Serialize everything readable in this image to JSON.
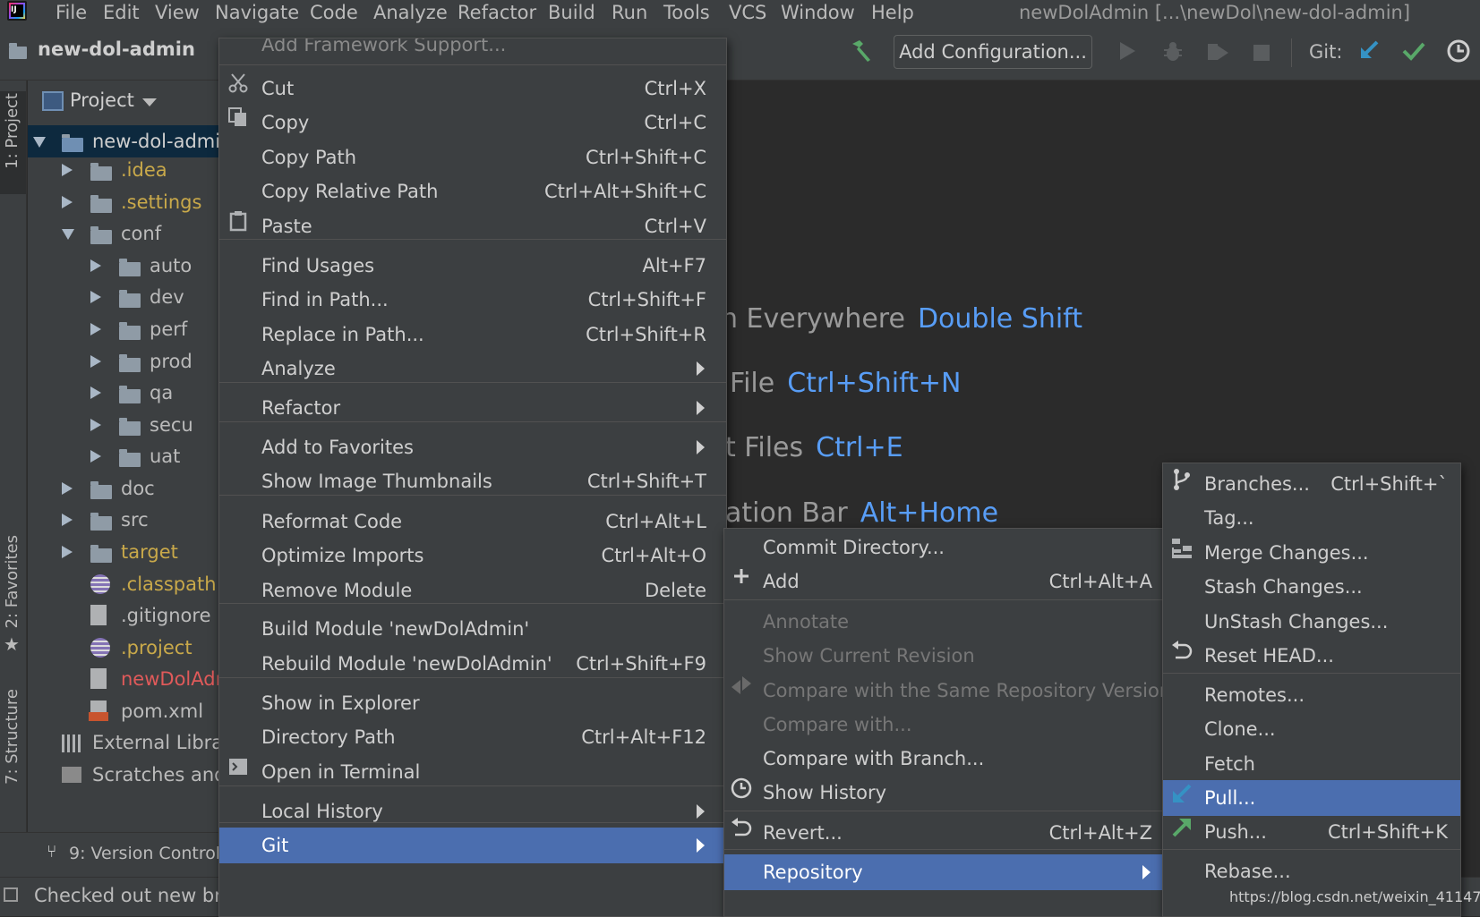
{
  "menubar": {
    "items": [
      "File",
      "Edit",
      "View",
      "Navigate",
      "Code",
      "Analyze",
      "Refactor",
      "Build",
      "Run",
      "Tools",
      "VCS",
      "Window",
      "Help"
    ],
    "window_title": "newDolAdmin [...\\newDol\\new-dol-admin]"
  },
  "toolbar": {
    "project_name": "new-dol-admin",
    "add_configuration": "Add Configuration...",
    "git_label": "Git:"
  },
  "left_stripe": {
    "project_tab": "1: Project",
    "favorites_tab": "2: Favorites",
    "structure_tab": "7: Structure"
  },
  "project_panel": {
    "header": "Project",
    "tree": [
      {
        "label": "new-dol-admi",
        "type": "module",
        "state": "down",
        "color": "#cfcfcf"
      },
      {
        "label": ".idea",
        "type": "folder",
        "state": "right",
        "color": "#c9a94a"
      },
      {
        "label": ".settings",
        "type": "folder",
        "state": "right",
        "color": "#c9a94a"
      },
      {
        "label": "conf",
        "type": "folder",
        "state": "down",
        "color": "#bbbbbb"
      },
      {
        "label": "auto",
        "type": "folder",
        "state": "right",
        "color": "#bbbbbb"
      },
      {
        "label": "dev",
        "type": "folder",
        "state": "right",
        "color": "#bbbbbb"
      },
      {
        "label": "perf",
        "type": "folder",
        "state": "right",
        "color": "#bbbbbb"
      },
      {
        "label": "prod",
        "type": "folder",
        "state": "right",
        "color": "#bbbbbb"
      },
      {
        "label": "qa",
        "type": "folder",
        "state": "right",
        "color": "#bbbbbb"
      },
      {
        "label": "secu",
        "type": "folder",
        "state": "right",
        "color": "#bbbbbb"
      },
      {
        "label": "uat",
        "type": "folder",
        "state": "right",
        "color": "#bbbbbb"
      },
      {
        "label": "doc",
        "type": "folder",
        "state": "right",
        "color": "#bbbbbb"
      },
      {
        "label": "src",
        "type": "folder",
        "state": "right",
        "color": "#bbbbbb"
      },
      {
        "label": "target",
        "type": "folder",
        "state": "right",
        "color": "#c9a94a"
      },
      {
        "label": ".classpath",
        "type": "eclipse",
        "state": "none",
        "color": "#c9a94a"
      },
      {
        "label": ".gitignore",
        "type": "file",
        "state": "none",
        "color": "#bbbbbb"
      },
      {
        "label": ".project",
        "type": "eclipse",
        "state": "none",
        "color": "#c9a94a"
      },
      {
        "label": "newDolAdı",
        "type": "file",
        "state": "none",
        "color": "#e05a5a"
      },
      {
        "label": "pom.xml",
        "type": "xml",
        "state": "none",
        "color": "#bbbbbb"
      },
      {
        "label": "External Librar",
        "type": "lib",
        "state": "none",
        "color": "#bbbbbb"
      },
      {
        "label": "Scratches and",
        "type": "scratch",
        "state": "none",
        "color": "#bbbbbb"
      }
    ]
  },
  "bottom": {
    "version_control": "9: Version Control",
    "status": "Checked out new bra"
  },
  "hints": [
    {
      "text": "h Everywhere",
      "key": "Double Shift"
    },
    {
      "text": "File",
      "key": "Ctrl+Shift+N"
    },
    {
      "text": "t Files",
      "key": "Ctrl+E"
    },
    {
      "text": "ation Bar",
      "key": "Alt+Home"
    }
  ],
  "context_menu": {
    "top_partial": "Add Framework Support...",
    "items": [
      {
        "label": "Cut",
        "shortcut": "Ctrl+X",
        "icon": "scissors-icon"
      },
      {
        "label": "Copy",
        "shortcut": "Ctrl+C",
        "icon": "copy-icon"
      },
      {
        "label": "Copy Path",
        "shortcut": "Ctrl+Shift+C"
      },
      {
        "label": "Copy Relative Path",
        "shortcut": "Ctrl+Alt+Shift+C"
      },
      {
        "label": "Paste",
        "shortcut": "Ctrl+V",
        "icon": "clipboard-icon"
      },
      {
        "label": "Find Usages",
        "shortcut": "Alt+F7"
      },
      {
        "label": "Find in Path...",
        "shortcut": "Ctrl+Shift+F"
      },
      {
        "label": "Replace in Path...",
        "shortcut": "Ctrl+Shift+R"
      },
      {
        "label": "Analyze",
        "submenu": true
      },
      {
        "label": "Refactor",
        "submenu": true
      },
      {
        "label": "Add to Favorites",
        "submenu": true
      },
      {
        "label": "Show Image Thumbnails",
        "shortcut": "Ctrl+Shift+T"
      },
      {
        "label": "Reformat Code",
        "shortcut": "Ctrl+Alt+L"
      },
      {
        "label": "Optimize Imports",
        "shortcut": "Ctrl+Alt+O"
      },
      {
        "label": "Remove Module",
        "shortcut": "Delete"
      },
      {
        "label": "Build Module 'newDolAdmin'",
        "shortcut": ""
      },
      {
        "label": "Rebuild Module 'newDolAdmin'",
        "shortcut": "Ctrl+Shift+F9"
      },
      {
        "label": "Show in Explorer",
        "shortcut": ""
      },
      {
        "label": "Directory Path",
        "shortcut": "Ctrl+Alt+F12"
      },
      {
        "label": "Open in Terminal",
        "shortcut": "",
        "icon": "terminal-icon"
      },
      {
        "label": "Local History",
        "submenu": true
      },
      {
        "label": "Git",
        "submenu": true,
        "selected": true
      }
    ]
  },
  "git_menu": {
    "items": [
      {
        "label": "Commit Directory...",
        "shortcut": ""
      },
      {
        "label": "Add",
        "shortcut": "Ctrl+Alt+A",
        "icon": "plus-icon"
      },
      {
        "label": "Annotate",
        "disabled": true
      },
      {
        "label": "Show Current Revision",
        "disabled": true
      },
      {
        "label": "Compare with the Same Repository Version",
        "disabled": true,
        "icon": "compare-icon"
      },
      {
        "label": "Compare with...",
        "disabled": true
      },
      {
        "label": "Compare with Branch...",
        "shortcut": ""
      },
      {
        "label": "Show History",
        "shortcut": "",
        "icon": "clock-icon"
      },
      {
        "label": "Revert...",
        "shortcut": "Ctrl+Alt+Z",
        "icon": "revert-icon"
      },
      {
        "label": "Repository",
        "submenu": true,
        "selected": true
      }
    ]
  },
  "repository_menu": {
    "items": [
      {
        "label": "Branches...",
        "shortcut": "Ctrl+Shift+`",
        "icon": "branch-icon"
      },
      {
        "label": "Tag...",
        "shortcut": ""
      },
      {
        "label": "Merge Changes...",
        "shortcut": "",
        "icon": "merge-icon"
      },
      {
        "label": "Stash Changes...",
        "shortcut": ""
      },
      {
        "label": "UnStash Changes...",
        "shortcut": ""
      },
      {
        "label": "Reset HEAD...",
        "shortcut": "",
        "icon": "reset-icon"
      },
      {
        "label": "Remotes...",
        "shortcut": ""
      },
      {
        "label": "Clone...",
        "shortcut": ""
      },
      {
        "label": "Fetch",
        "shortcut": ""
      },
      {
        "label": "Pull...",
        "shortcut": "",
        "icon": "pull-icon",
        "selected": true
      },
      {
        "label": "Push...",
        "shortcut": "Ctrl+Shift+K",
        "icon": "push-icon"
      },
      {
        "label": "Rebase...",
        "shortcut": ""
      }
    ]
  },
  "watermark": "https://blog.csdn.net/weixin_41147129"
}
